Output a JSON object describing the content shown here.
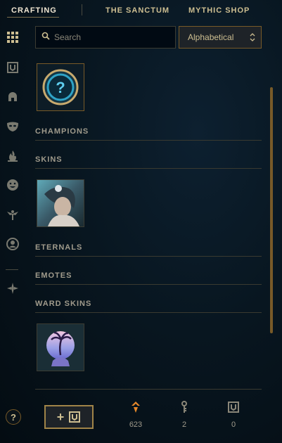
{
  "nav": {
    "tabs": [
      {
        "label": "CRAFTING"
      },
      {
        "label": "THE SANCTUM"
      },
      {
        "label": "MYTHIC SHOP"
      }
    ]
  },
  "search": {
    "placeholder": "Search"
  },
  "sort": {
    "value": "Alphabetical"
  },
  "sidebar": {
    "icons": [
      "grid-icon",
      "chest-icon",
      "helmet-icon",
      "mask-icon",
      "flame-icon",
      "emote-icon",
      "ward-icon",
      "icon-icon",
      "sanctum-icon"
    ]
  },
  "sections": {
    "champions": "CHAMPIONS",
    "skins": "SKINS",
    "eternals": "ETERNALS",
    "emotes": "EMOTES",
    "ward_skins": "WARD SKINS"
  },
  "bottom": {
    "help_label": "?",
    "add_label": "+",
    "blue_essence": "623",
    "keys": "2",
    "chests": "0"
  },
  "colors": {
    "gold": "#c8aa6e",
    "accent_orange": "#e8892a",
    "background": "#081620"
  }
}
